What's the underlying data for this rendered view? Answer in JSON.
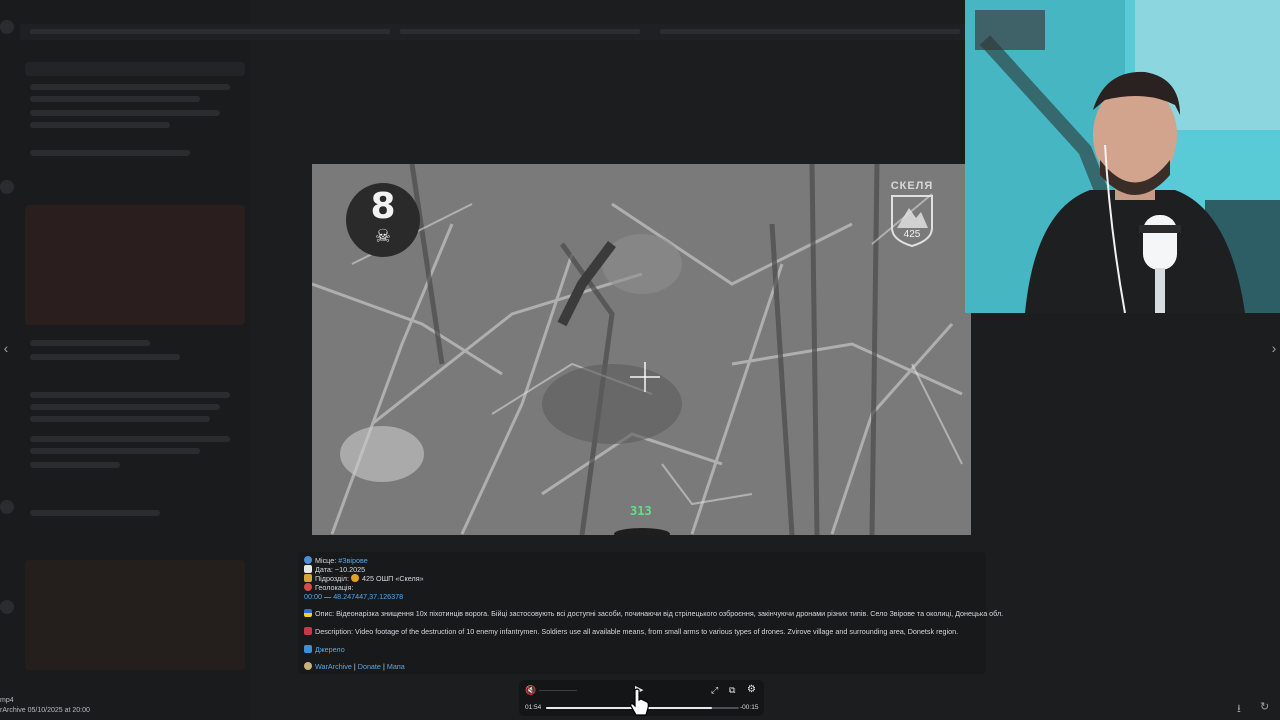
{
  "viewer": {
    "prev_arrow": "‹",
    "next_arrow": "›"
  },
  "video": {
    "kill_count": "8",
    "kill_icon": "skull-crossbones-icon",
    "unit_logo_name": "СКЕЛЯ",
    "unit_logo_code": "425",
    "hud_readout": "313"
  },
  "caption": {
    "place_label": "Місце:",
    "place_value": "#Звірове",
    "date_label": "Дата:",
    "date_value": "~10.2025",
    "unit_label": "Підрозділ:",
    "unit_value": "425 ОШП «Скеля»",
    "geo_label": "Геолокація:",
    "geo_time": "00:00",
    "geo_sep": "—",
    "geo_coords": "48.247447,37.126378",
    "opys": "Опис: Відеонарізка знищення 10х піхотинців ворога. Бійці застосовують всі доступні засоби, починаючи від стрілецького озброєння, закінчуючи дронами різних типів. Село Звірове та околиці, Донецька обл.",
    "description": "Description: Video footage of the destruction of 10 enemy infantrymen. Soldiers use all available means, from small arms to various types of drones. Zvirove village and surrounding area, Donetsk region.",
    "source": "Джерело",
    "footer_archive": "WarArchive",
    "footer_sep1": "|",
    "footer_donate": "Donate",
    "footer_sep2": "|",
    "footer_mapa": "Мапа"
  },
  "file_info": {
    "ext": "mp4",
    "meta": "rArchive  05/10/2025 at 20:00"
  },
  "player": {
    "current_time": "01:54",
    "remaining_time": "-00:15",
    "progress": 0.86,
    "volume": 0.0,
    "mute_icon": "volume-muted-icon",
    "play_icon": "play-icon",
    "fullscreen_icon": "fullscreen-icon",
    "pip_icon": "picture-in-picture-icon",
    "settings_icon": "settings-gear-icon"
  },
  "colors": {
    "accent_link": "#5aa7e6",
    "hud_green": "#5de08a",
    "webcam_bg": "#4fc9d6"
  }
}
